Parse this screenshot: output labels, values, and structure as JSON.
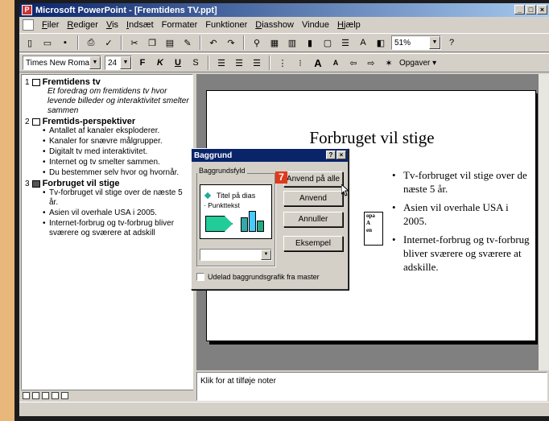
{
  "window": {
    "title": "Microsoft PowerPoint - [Fremtidens TV.ppt]",
    "controls": [
      "_",
      "□",
      "×"
    ]
  },
  "menu": {
    "items": [
      {
        "u": "F",
        "rest": "iler"
      },
      {
        "u": "R",
        "rest": "ediger"
      },
      {
        "u": "V",
        "rest": "is"
      },
      {
        "u": "I",
        "rest": "ndsæt"
      },
      {
        "u": "",
        "rest": "Formater"
      },
      {
        "u": "",
        "rest": "Funktioner"
      },
      {
        "u": "D",
        "rest": "iasshow"
      },
      {
        "u": "",
        "rest": "Vindue"
      },
      {
        "u": "H",
        "rest": "jælp"
      }
    ]
  },
  "toolbar": {
    "zoom": "51%",
    "font_name": "Times New Roman",
    "font_size": "24",
    "tasks_label": "Opgaver"
  },
  "outline": {
    "slides": [
      {
        "num": "1",
        "title": "Fremtidens tv",
        "subtitle": "Et foredrag om fremtidens tv hvor levende billeder og interaktivitet smelter sammen",
        "bullets": []
      },
      {
        "num": "2",
        "title": "Fremtids-perspektiver",
        "subtitle": "",
        "bullets": [
          "Antallet af kanaler eksploderer.",
          "Kanaler for snævre målgrupper.",
          "Digitalt tv med interaktivitet.",
          "Internet og tv smelter sammen.",
          "Du bestemmer selv hvor og hvornår."
        ]
      },
      {
        "num": "3",
        "title": "Forbruget vil stige",
        "subtitle": "",
        "bullets": [
          "Tv-forbruget vil stige over de næste 5 år.",
          "Asien vil overhale USA i 2005.",
          "Internet-forbrug og tv-forbrug bliver sværere og sværere at adskill"
        ]
      }
    ]
  },
  "slide": {
    "title": "Forbruget vil stige",
    "bullets": [
      "Tv-forbruget vil stige over de næste 5 år.",
      "Asien vil overhale USA i 2005.",
      "Internet-forbrug og tv-forbrug bliver sværere og sværere at adskille."
    ],
    "partial_box_text": "opa\nA\nen"
  },
  "notes": {
    "placeholder": "Klik for at tilføje noter"
  },
  "dialog": {
    "title": "Baggrund",
    "title_buttons": [
      "?",
      "×"
    ],
    "group_label": "Baggrundsfyld",
    "preview_title": "Titel på dias",
    "preview_bullet": "Punkttekst",
    "buttons": {
      "apply_all": "Anvend på alle",
      "apply": "Anvend",
      "cancel": "Annuller",
      "preview": "Eksempel"
    },
    "checkbox_label": "Udelad baggrundsgrafik fra master"
  },
  "annotation": {
    "step": "7"
  },
  "colors": {
    "titlebar": "#0a246a",
    "step_badge": "#e03a1e",
    "preview_shape": "#22cc99"
  }
}
